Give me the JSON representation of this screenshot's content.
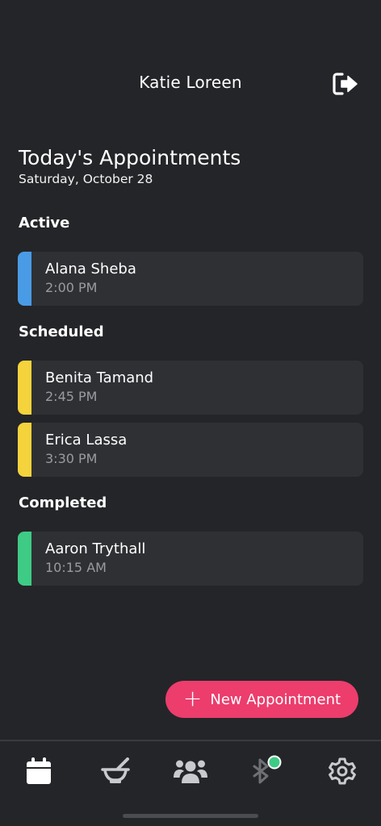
{
  "header": {
    "title": "Katie Loreen",
    "logout_icon": "logout-icon"
  },
  "page": {
    "title": "Today's Appointments",
    "date": "Saturday, October 28"
  },
  "sections": {
    "active": {
      "label": "Active",
      "items": [
        {
          "name": "Alana Sheba",
          "time": "2:00 PM",
          "color": "#4a9be6"
        }
      ]
    },
    "scheduled": {
      "label": "Scheduled",
      "items": [
        {
          "name": "Benita Tamand",
          "time": "2:45 PM",
          "color": "#f5d33c"
        },
        {
          "name": "Erica Lassa",
          "time": "3:30 PM",
          "color": "#f5d33c"
        }
      ]
    },
    "completed": {
      "label": "Completed",
      "items": [
        {
          "name": "Aaron Trythall",
          "time": "10:15 AM",
          "color": "#3ecb86"
        }
      ]
    }
  },
  "fab": {
    "label": "New Appointment"
  },
  "tabbar": {
    "tabs": [
      {
        "icon": "calendar-icon",
        "active": true
      },
      {
        "icon": "mortar-pestle-icon",
        "active": false
      },
      {
        "icon": "users-group-icon",
        "active": false
      },
      {
        "icon": "bluetooth-icon",
        "active": false,
        "status_color": "#3ecb86"
      },
      {
        "icon": "settings-gear-icon",
        "active": false
      }
    ]
  },
  "colors": {
    "background": "#242528",
    "card": "#2f3034",
    "accent": "#ec3d6d",
    "muted_text": "#9a9ba0",
    "icon": "#c9cacd"
  }
}
